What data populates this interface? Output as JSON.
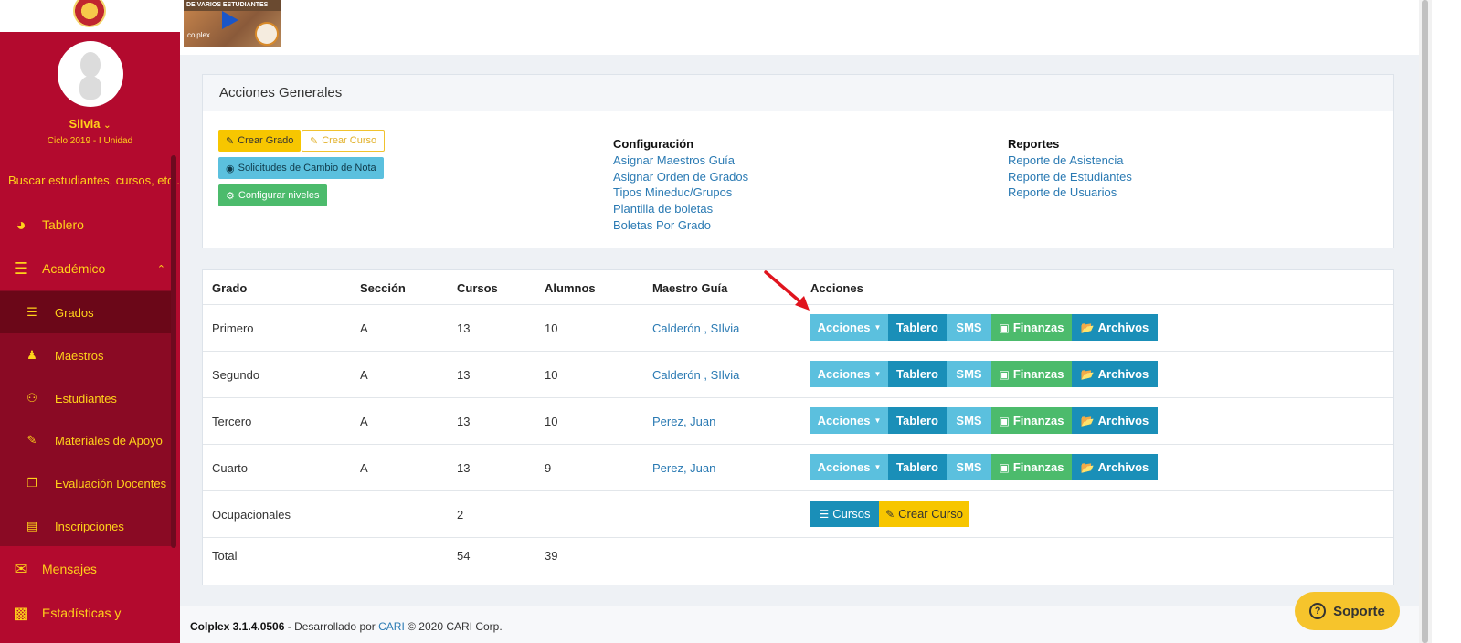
{
  "sidebar": {
    "user_name": "Silvia",
    "user_cycle": "Ciclo 2019 - I Unidad",
    "search_text": "Buscar estudiantes, cursos, etc...",
    "items": [
      {
        "label": "Tablero",
        "icon": "dashboard-icon"
      },
      {
        "label": "Académico",
        "icon": "list-icon"
      },
      {
        "label": "Mensajes",
        "icon": "envelope-icon"
      },
      {
        "label": "Estadísticas y",
        "icon": "bar-chart-icon"
      }
    ],
    "subitems": [
      {
        "label": "Grados",
        "icon": "list-icon"
      },
      {
        "label": "Maestros",
        "icon": "person-icon"
      },
      {
        "label": "Estudiantes",
        "icon": "users-icon"
      },
      {
        "label": "Materiales de Apoyo",
        "icon": "paperclip-icon"
      },
      {
        "label": "Evaluación Docentes",
        "icon": "copy-icon"
      },
      {
        "label": "Inscripciones",
        "icon": "book-icon"
      }
    ]
  },
  "thumbnail": {
    "band_text": "DE VARIOS ESTUDIANTES",
    "brand": "colplex"
  },
  "acciones_generales": {
    "title": "Acciones Generales",
    "crear_grado": "Crear Grado",
    "crear_curso": "Crear Curso",
    "solicitudes": "Solicitudes de Cambio de Nota",
    "configurar_niveles": "Configurar niveles",
    "configuracion": {
      "title": "Configuración",
      "links": [
        "Asignar Maestros Guía",
        "Asignar Orden de Grados",
        "Tipos Mineduc/Grupos",
        "Plantilla de boletas",
        "Boletas Por Grado"
      ]
    },
    "reportes": {
      "title": "Reportes",
      "links": [
        "Reporte de Asistencia",
        "Reporte de Estudiantes",
        "Reporte de Usuarios"
      ]
    }
  },
  "table": {
    "headers": [
      "Grado",
      "Sección",
      "Cursos",
      "Alumnos",
      "Maestro Guía",
      "Acciones"
    ],
    "rows": [
      {
        "grado": "Primero",
        "seccion": "A",
        "cursos": "13",
        "alumnos": "10",
        "maestro": "Calderón , SIlvia"
      },
      {
        "grado": "Segundo",
        "seccion": "A",
        "cursos": "13",
        "alumnos": "10",
        "maestro": "Calderón , SIlvia"
      },
      {
        "grado": "Tercero",
        "seccion": "A",
        "cursos": "13",
        "alumnos": "10",
        "maestro": "Perez, Juan"
      },
      {
        "grado": "Cuarto",
        "seccion": "A",
        "cursos": "13",
        "alumnos": "9",
        "maestro": "Perez, Juan"
      }
    ],
    "ocupacionales": {
      "grado": "Ocupacionales",
      "cursos": "2"
    },
    "total": {
      "label": "Total",
      "cursos": "54",
      "alumnos": "39"
    },
    "action_labels": {
      "acciones": "Acciones",
      "tablero": "Tablero",
      "sms": "SMS",
      "finanzas": "Finanzas",
      "archivos": "Archivos",
      "cursos": "Cursos",
      "crear_curso": "Crear Curso"
    }
  },
  "footer": {
    "product": "Colplex 3.1.4.0506",
    "dev_text": " - Desarrollado por ",
    "company_link": "CARI",
    "copyright": " © 2020 CARI Corp."
  },
  "support": {
    "label": "Soporte"
  },
  "colors": {
    "sidebar": "#b30a2e",
    "accent": "#ffd21a",
    "info": "#5bc0de",
    "primary": "#1a8fb8",
    "success": "#4cbb6c",
    "warning": "#f7c600"
  }
}
